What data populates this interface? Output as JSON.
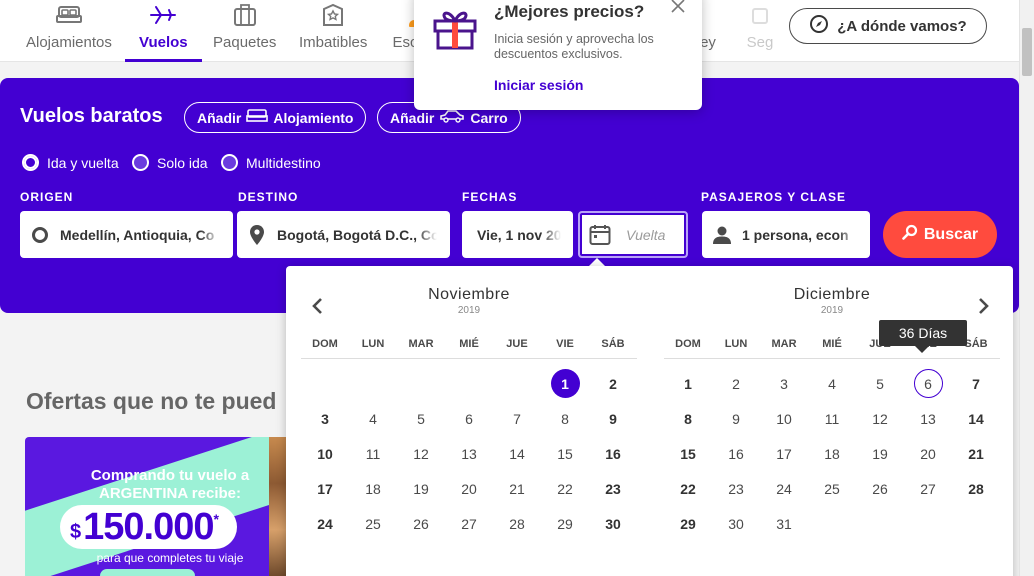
{
  "nav": {
    "items": [
      {
        "label": "Alojamientos",
        "icon": "bed-icon"
      },
      {
        "label": "Vuelos",
        "icon": "plane-icon",
        "active": true
      },
      {
        "label": "Paquetes",
        "icon": "suitcase-icon"
      },
      {
        "label": "Imbatibles",
        "icon": "hotel-icon"
      },
      {
        "label": "Esc",
        "icon": "escapadas-icon"
      },
      {
        "label": "ey",
        "icon": "disney-icon"
      },
      {
        "label": "Seg",
        "icon": "seguros-icon"
      }
    ],
    "destination_button": "¿A dónde vamos?"
  },
  "popup": {
    "title": "¿Mejores precios?",
    "text": "Inicia sesión y aprovecha los descuentos exclusivos.",
    "link": "Iniciar sesión"
  },
  "search": {
    "title": "Vuelos baratos",
    "add_prefix": "Añadir",
    "add_lodging": "Alojamiento",
    "add_car": "Carro",
    "trip_types": [
      "Ida y vuelta",
      "Solo ida",
      "Multidestino"
    ],
    "selected_trip_type": "Ida y vuelta",
    "labels": {
      "origin": "ORIGEN",
      "destination": "DESTINO",
      "dates": "FECHAS",
      "passengers": "PASAJEROS Y CLASE"
    },
    "origin_value": "Medellín, Antioquia, Co",
    "destination_value": "Bogotá, Bogotá D.C., Co",
    "departure_value": "Vie, 1 nov 20",
    "return_placeholder": "Vuelta",
    "passengers_value": "1 persona, econ",
    "search_button": "Buscar"
  },
  "offers": {
    "title": "Ofertas que no te pued",
    "promo_line1": "Comprando tu vuelo a ARGENTINA recibe:",
    "promo_currency": "$",
    "promo_amount": "150.000",
    "promo_star": "*",
    "promo_line2": "para que completes tu viaje"
  },
  "calendar": {
    "tooltip": "36 Días",
    "weekdays": [
      "DOM",
      "LUN",
      "MAR",
      "MIÉ",
      "JUE",
      "VIE",
      "SÁB"
    ],
    "months": [
      {
        "name": "Noviembre",
        "year": "2019",
        "weeks": [
          [
            "",
            "",
            "",
            "",
            "",
            "1",
            "2"
          ],
          [
            "3",
            "4",
            "5",
            "6",
            "7",
            "8",
            "9"
          ],
          [
            "10",
            "11",
            "12",
            "13",
            "14",
            "15",
            "16"
          ],
          [
            "17",
            "18",
            "19",
            "20",
            "21",
            "22",
            "23"
          ],
          [
            "24",
            "25",
            "26",
            "27",
            "28",
            "29",
            "30"
          ]
        ],
        "selected": "1"
      },
      {
        "name": "Diciembre",
        "year": "2019",
        "weeks": [
          [
            "1",
            "2",
            "3",
            "4",
            "5",
            "6",
            "7"
          ],
          [
            "8",
            "9",
            "10",
            "11",
            "12",
            "13",
            "14"
          ],
          [
            "15",
            "16",
            "17",
            "18",
            "19",
            "20",
            "21"
          ],
          [
            "22",
            "23",
            "24",
            "25",
            "26",
            "27",
            "28"
          ],
          [
            "29",
            "30",
            "31",
            "",
            "",
            "",
            ""
          ]
        ],
        "hovered": "6"
      }
    ]
  },
  "colors": {
    "brand": "#4300d2",
    "cta": "#ff4b3e",
    "mint": "#9cf1d6"
  }
}
